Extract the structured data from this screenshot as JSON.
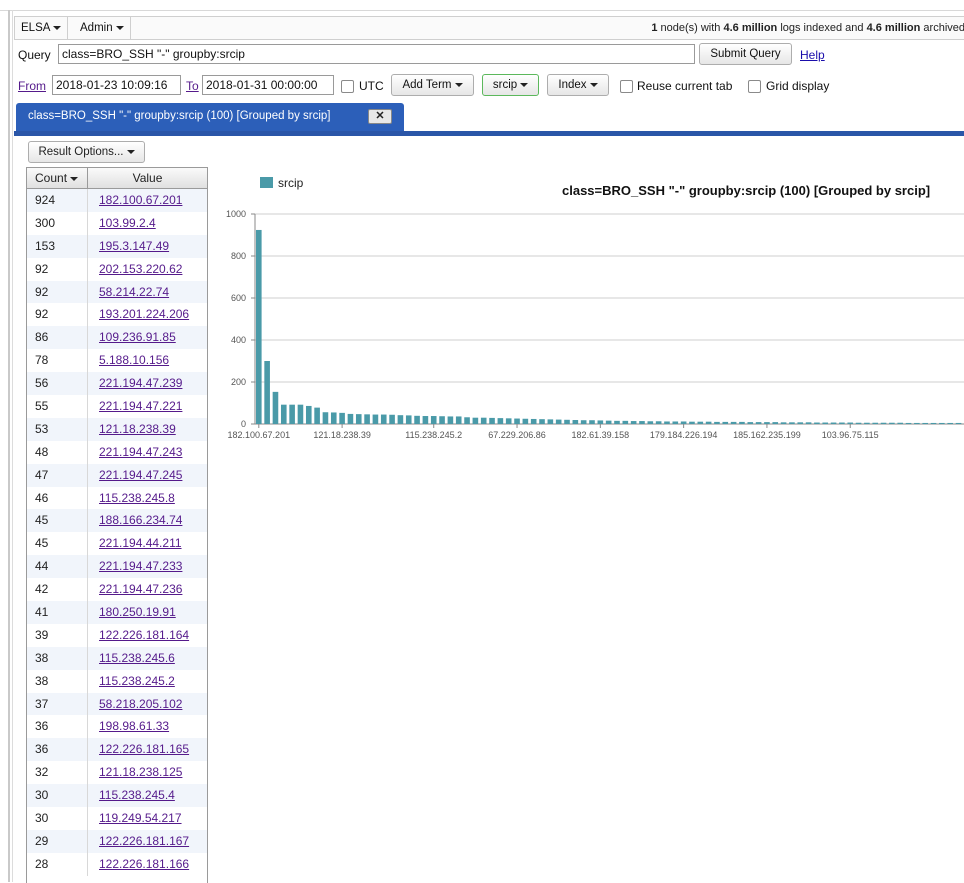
{
  "menubar": {
    "elsa_label": "ELSA",
    "admin_label": "Admin",
    "status": {
      "node_count": "1",
      "text1": " node(s) with ",
      "indexed": "4.6 million",
      "text2": " logs indexed and ",
      "archived": "4.6 million",
      "text3": " archived"
    }
  },
  "query": {
    "label": "Query",
    "value": "class=BRO_SSH \"-\" groupby:srcip",
    "submit_label": "Submit Query",
    "help_label": "Help"
  },
  "time": {
    "from_label": "From",
    "from_value": "2018-01-23 10:09:16",
    "to_label": "To",
    "to_value": "2018-01-31 00:00:00",
    "utc_label": "UTC",
    "add_term_label": "Add Term",
    "srcip_label": "srcip",
    "index_label": "Index",
    "reuse_tab_label": "Reuse current tab",
    "grid_display_label": "Grid display"
  },
  "tab": {
    "label": "class=BRO_SSH \"-\" groupby:srcip (100) [Grouped by srcip]",
    "close_label": "✕"
  },
  "result_options_label": "Result Options...",
  "table": {
    "headers": {
      "count": "Count",
      "value": "Value"
    },
    "rows": [
      {
        "count": "924",
        "value": "182.100.67.201"
      },
      {
        "count": "300",
        "value": "103.99.2.4"
      },
      {
        "count": "153",
        "value": "195.3.147.49"
      },
      {
        "count": "92",
        "value": "202.153.220.62"
      },
      {
        "count": "92",
        "value": "58.214.22.74"
      },
      {
        "count": "92",
        "value": "193.201.224.206"
      },
      {
        "count": "86",
        "value": "109.236.91.85"
      },
      {
        "count": "78",
        "value": "5.188.10.156"
      },
      {
        "count": "56",
        "value": "221.194.47.239"
      },
      {
        "count": "55",
        "value": "221.194.47.221"
      },
      {
        "count": "53",
        "value": "121.18.238.39"
      },
      {
        "count": "48",
        "value": "221.194.47.243"
      },
      {
        "count": "47",
        "value": "221.194.47.245"
      },
      {
        "count": "46",
        "value": "115.238.245.8"
      },
      {
        "count": "45",
        "value": "188.166.234.74"
      },
      {
        "count": "45",
        "value": "221.194.44.211"
      },
      {
        "count": "44",
        "value": "221.194.47.233"
      },
      {
        "count": "42",
        "value": "221.194.47.236"
      },
      {
        "count": "41",
        "value": "180.250.19.91"
      },
      {
        "count": "39",
        "value": "122.226.181.164"
      },
      {
        "count": "38",
        "value": "115.238.245.6"
      },
      {
        "count": "38",
        "value": "115.238.245.2"
      },
      {
        "count": "37",
        "value": "58.218.205.102"
      },
      {
        "count": "36",
        "value": "198.98.61.33"
      },
      {
        "count": "36",
        "value": "122.226.181.165"
      },
      {
        "count": "32",
        "value": "121.18.238.125"
      },
      {
        "count": "30",
        "value": "115.238.245.4"
      },
      {
        "count": "30",
        "value": "119.249.54.217"
      },
      {
        "count": "29",
        "value": "122.226.181.167"
      },
      {
        "count": "28",
        "value": "122.226.181.166"
      }
    ]
  },
  "chart_data": {
    "type": "bar",
    "title": "class=BRO_SSH \"-\" groupby:srcip (100) [Grouped by srcip]",
    "xlabel": "",
    "ylabel": "",
    "ylim": [
      0,
      1000
    ],
    "yticks": [
      0,
      200,
      400,
      600,
      800,
      1000
    ],
    "grid": true,
    "legend_position": "top-left",
    "bar_color": "#4a9aa8",
    "series": [
      {
        "name": "srcip",
        "values": [
          924,
          300,
          153,
          92,
          92,
          92,
          86,
          78,
          56,
          55,
          53,
          48,
          47,
          46,
          45,
          45,
          44,
          42,
          41,
          39,
          38,
          38,
          37,
          36,
          36,
          32,
          30,
          30,
          29,
          28,
          27,
          26,
          25,
          24,
          23,
          22,
          21,
          20,
          19,
          18,
          18,
          17,
          16,
          15,
          15,
          14,
          14,
          13,
          13,
          12,
          12,
          12,
          11,
          11,
          11,
          10,
          10,
          10,
          10,
          9,
          9,
          9,
          9,
          8,
          8,
          8,
          8,
          7,
          7,
          7,
          7,
          7,
          6,
          6,
          6,
          6,
          6,
          6,
          5,
          5,
          5,
          5,
          5,
          5,
          5,
          4,
          4,
          4,
          4,
          4,
          4,
          4,
          4,
          4,
          3,
          3,
          3,
          3,
          3,
          3
        ]
      }
    ],
    "x_tick_labels": [
      {
        "index": 0,
        "label": "182.100.67.201"
      },
      {
        "index": 10,
        "label": "121.18.238.39"
      },
      {
        "index": 21,
        "label": "115.238.245.2"
      },
      {
        "index": 31,
        "label": "67.229.206.86"
      },
      {
        "index": 41,
        "label": "182.61.39.158"
      },
      {
        "index": 51,
        "label": "179.184.226.194"
      },
      {
        "index": 61,
        "label": "185.162.235.199"
      },
      {
        "index": 71,
        "label": "103.96.75.115"
      }
    ]
  }
}
